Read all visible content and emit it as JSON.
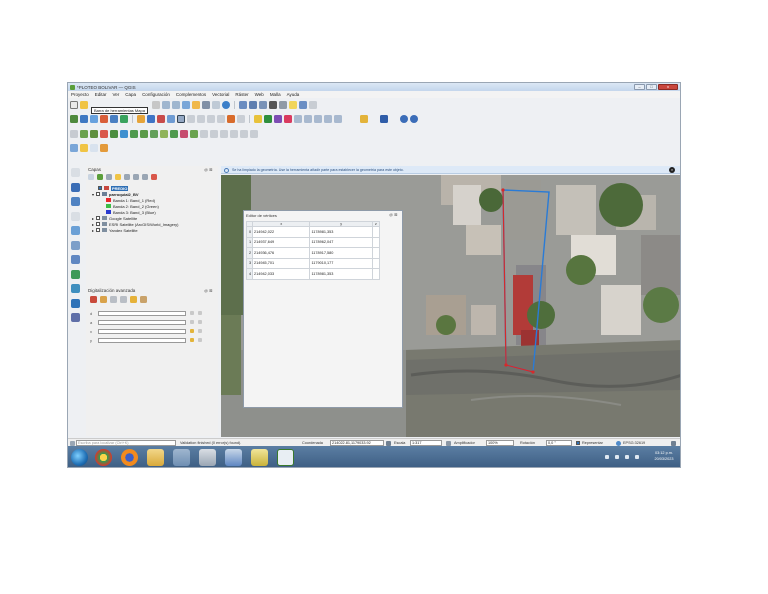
{
  "window": {
    "title": "*PLOTEO BOLIVAR — QGIS",
    "controls": {
      "minimize": "–",
      "maximize": "□",
      "close": "x"
    }
  },
  "menubar": [
    "Proyecto",
    "Editar",
    "Ver",
    "Capa",
    "Configuración",
    "Complementos",
    "Vectorial",
    "Ráster",
    "Web",
    "Malla",
    "Ayuda"
  ],
  "tooltip": "Barra de herramientas Mapa",
  "layers_panel": {
    "title": "Capas",
    "dock_buttons": "@ ⊠",
    "layers": [
      {
        "label": "PREDIO",
        "checked": true,
        "selected": true,
        "level": 0
      },
      {
        "label": "parroquial2_BV",
        "checked": true,
        "bold": true,
        "level": 0
      },
      {
        "label": "Banda 1: Band_1 (Red)",
        "swatch": "#e8262b",
        "level": 2
      },
      {
        "label": "Banda 2: Band_2 (Green)",
        "swatch": "#3bbd45",
        "level": 2
      },
      {
        "label": "Banda 3: Band_3 (Blue)",
        "swatch": "#2a3bd1",
        "level": 2
      },
      {
        "label": "Google Satellite",
        "checked": false,
        "level": 0
      },
      {
        "label": "ESRI Satellite (ArcGIS/World_Imagery)",
        "checked": false,
        "level": 0
      },
      {
        "label": "Yandex Satellite",
        "checked": false,
        "level": 0
      }
    ]
  },
  "digitize_panel": {
    "title": "Digitalización avanzada",
    "dock_buttons": "@ ⊠",
    "fields": [
      {
        "label": "d",
        "locked": false
      },
      {
        "label": "a",
        "locked": false
      },
      {
        "label": "x",
        "locked": true
      },
      {
        "label": "y",
        "locked": true
      }
    ]
  },
  "message_bar": {
    "text": "Se ha limpiado la geometría. Use la herramienta añadir parte para establecer la geometría para este objeto.",
    "close": "×"
  },
  "vertex_editor": {
    "title": "Editor de vértices",
    "dock_buttons": "@ ⊠",
    "columns": [
      "x",
      "y",
      "z"
    ],
    "rows": [
      {
        "index": "0",
        "x": "214942,022",
        "y": "1178981,353",
        "z": ""
      },
      {
        "index": "1",
        "x": "214937,649",
        "y": "1178962,047",
        "z": ""
      },
      {
        "index": "2",
        "x": "214936,476",
        "y": "1178917,580",
        "z": ""
      },
      {
        "index": "3",
        "x": "214945,701",
        "y": "1179010,177",
        "z": ""
      },
      {
        "index": "4",
        "x": "214942,033",
        "y": "1178981,353",
        "z": ""
      }
    ]
  },
  "statusbar": {
    "search_placeholder": "Escriba para localizar (Ctrl+K)",
    "message": "Validation finished (0 error(s) found).",
    "coord_label": "Coordenada",
    "coord_value": "214022.81,1179033.92",
    "scale_label": "Escala",
    "scale_value": "1:317",
    "magnifier_label": "Amplificador",
    "magnifier_value": "100%",
    "rotation_label": "Rotación",
    "rotation_value": "0,0 °",
    "render_label": "Representar",
    "crs": "EPSG:32619"
  },
  "taskbar": {
    "time": "03:12 p.m.",
    "date": "20/03/2023"
  }
}
